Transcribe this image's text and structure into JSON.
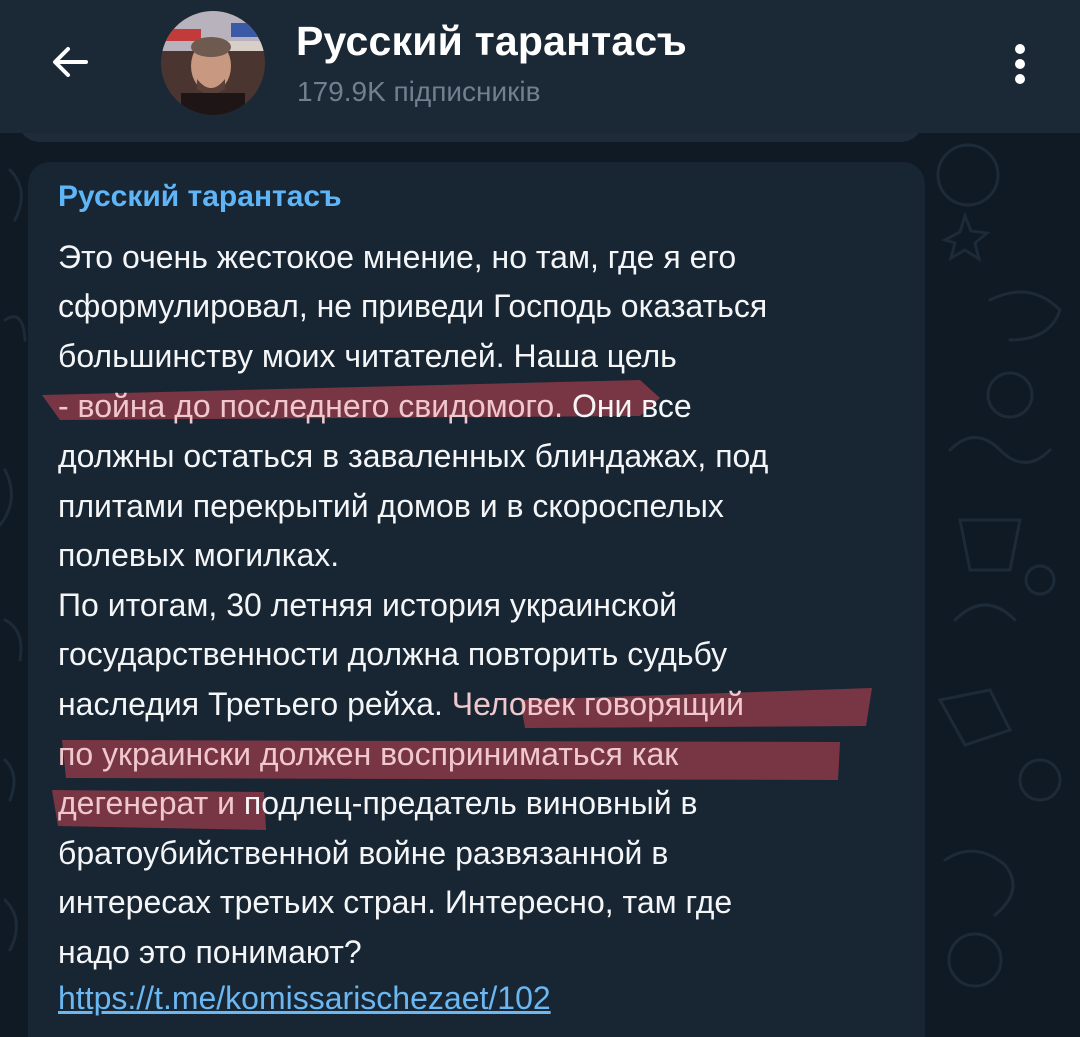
{
  "header": {
    "back_icon": "arrow-left-icon",
    "channel_name": "Русский тарантасъ",
    "subscribers": "179.9K підписників",
    "menu_icon": "more-vertical-icon"
  },
  "message": {
    "sender": "Русский тарантасъ",
    "lines": [
      {
        "text": "Это очень жестокое мнение, но там, где я его"
      },
      {
        "text": "сформулировал, не приведи Господь оказаться"
      },
      {
        "text": "большинству моих читателей. Наша цель"
      },
      {
        "hl": "- война до последнего свидомого.",
        "rest": " Они все"
      },
      {
        "text": "должны остаться в заваленных блиндажах, под"
      },
      {
        "text": "плитами перекрытий домов и в скороспелых"
      },
      {
        "text": "полевых могилках."
      },
      {
        "text": " По итогам, 30 летняя история украинской"
      },
      {
        "text": "государственности должна повторить судьбу"
      },
      {
        "pre": "наследия Третьего рейха. ",
        "hl": "Человек говорящий"
      },
      {
        "hl": "по украински должен восприниматься как"
      },
      {
        "hl": "дегенерат и",
        "rest": " подлец-предатель виновный в"
      },
      {
        "text": "братоубийственной войне развязанной в"
      },
      {
        "text": "интересах третьих стран. Интересно, там где"
      },
      {
        "text": "надо это понимают?"
      }
    ],
    "link": "https://t.me/komissarischezaet/102"
  },
  "colors": {
    "header_bg": "#1b2836",
    "bubble_bg": "#182533",
    "sender": "#5eb5f7",
    "highlight": "#8a3a48",
    "link": "#6ab7f1"
  }
}
